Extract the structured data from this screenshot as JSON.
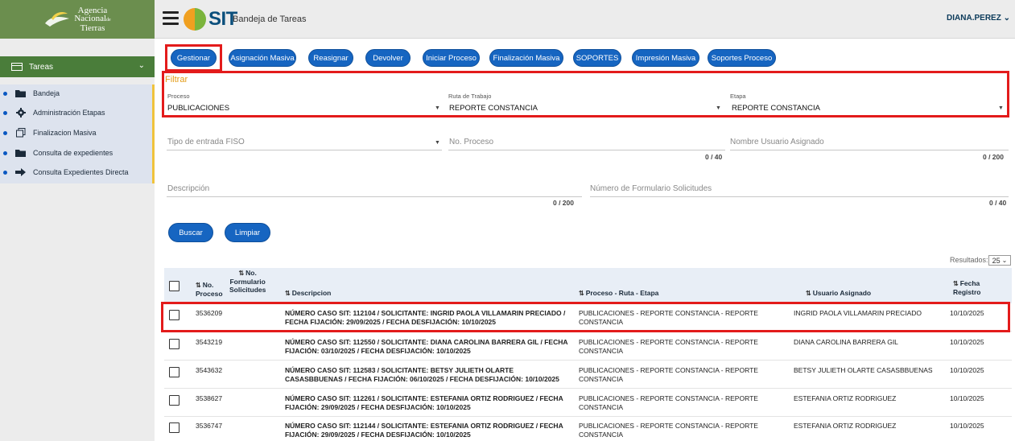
{
  "header": {
    "logo_lines": [
      "Agencia",
      "Nacional",
      "Tierras"
    ],
    "logo_small": "de",
    "brand": "SIT",
    "app_title": "Bandeja de Tareas",
    "user": "DIANA.PEREZ",
    "user_caret": "⌄"
  },
  "sidebar": {
    "section_label": "Tareas",
    "section_chevron": "⌄",
    "items": [
      {
        "label": "Bandeja",
        "icon": "folder-open-icon"
      },
      {
        "label": "Administración Etapas",
        "icon": "gear-icon"
      },
      {
        "label": "Finalizacion Masiva",
        "icon": "copy-icon"
      },
      {
        "label": "Consulta de expedientes",
        "icon": "folder-open-icon"
      },
      {
        "label": "Consulta Expedientes Directa",
        "icon": "arrow-right-icon"
      }
    ]
  },
  "toolbar": {
    "gestionar": "Gestionar",
    "asignacion_masiva": "Asignación Masiva",
    "reasignar": "Reasignar",
    "devolver": "Devolver",
    "iniciar_proceso": "Iniciar Proceso",
    "finalizacion_masiva": "Finalización Masiva",
    "soportes": "SOPORTES",
    "impresion_masiva": "Impresión Masiva",
    "soportes_proceso": "Soportes Proceso"
  },
  "filter": {
    "title": "Filtrar",
    "proceso_label": "Proceso",
    "proceso_value": "PUBLICACIONES",
    "ruta_label": "Ruta de Trabajo",
    "ruta_value": "REPORTE CONSTANCIA",
    "etapa_label": "Etapa",
    "etapa_value": "REPORTE CONSTANCIA",
    "tipo_entrada_placeholder": "Tipo de entrada FISO",
    "no_proceso_placeholder": "No. Proceso",
    "no_proceso_counter": "0 / 40",
    "nombre_usuario_placeholder": "Nombre Usuario Asignado",
    "nombre_usuario_counter": "0 / 200",
    "descripcion_placeholder": "Descripción",
    "descripcion_counter": "0 / 200",
    "numero_formulario_placeholder": "Número de Formulario Solicitudes",
    "numero_formulario_counter": "0 / 40",
    "buscar": "Buscar",
    "limpiar": "Limpiar"
  },
  "results": {
    "label": "Resultados:",
    "page_size": "25",
    "page_size_caret": "⌄"
  },
  "table": {
    "headers": {
      "no_proceso": [
        "No.",
        "Proceso"
      ],
      "no_formulario": [
        "No.",
        "Formulario",
        "Solicitudes"
      ],
      "descripcion": "Descripcion",
      "proceso_ruta_etapa": "Proceso - Ruta - Etapa",
      "usuario_asignado": "Usuario Asignado",
      "fecha_registro": [
        "Fecha",
        "Registro"
      ]
    },
    "rows": [
      {
        "proceso": "3536209",
        "desc1": "NÚMERO CASO SIT: 112104 / SOLICITANTE: INGRID PAOLA VILLAMARIN PRECIADO /",
        "desc2": "FECHA FIJACIÓN: 29/09/2025 / FECHA DESFIJACIÓN: 10/10/2025",
        "pre1": "PUBLICACIONES - REPORTE CONSTANCIA - REPORTE",
        "pre2": "CONSTANCIA",
        "usuario": "INGRID PAOLA VILLAMARIN PRECIADO",
        "fecha": "10/10/2025"
      },
      {
        "proceso": "3543219",
        "desc1": "NÚMERO CASO SIT: 112550 / SOLICITANTE: DIANA CAROLINA BARRERA GIL / FECHA",
        "desc2": "FIJACIÓN: 03/10/2025 / FECHA DESFIJACIÓN: 10/10/2025",
        "pre1": "PUBLICACIONES - REPORTE CONSTANCIA - REPORTE",
        "pre2": "CONSTANCIA",
        "usuario": "DIANA CAROLINA BARRERA GIL",
        "fecha": "10/10/2025"
      },
      {
        "proceso": "3543632",
        "desc1": "NÚMERO CASO SIT: 112583 / SOLICITANTE: BETSY JULIETH OLARTE",
        "desc2": "CASASBBUENAS / FECHA FIJACIÓN: 06/10/2025 / FECHA DESFIJACIÓN: 10/10/2025",
        "pre1": "PUBLICACIONES - REPORTE CONSTANCIA - REPORTE",
        "pre2": "CONSTANCIA",
        "usuario": "BETSY JULIETH OLARTE CASASBBUENAS",
        "fecha": "10/10/2025"
      },
      {
        "proceso": "3538627",
        "desc1": "NÚMERO CASO SIT: 112261 / SOLICITANTE: ESTEFANIA ORTIZ RODRIGUEZ / FECHA",
        "desc2": "FIJACIÓN: 29/09/2025 / FECHA DESFIJACIÓN: 10/10/2025",
        "pre1": "PUBLICACIONES - REPORTE CONSTANCIA - REPORTE",
        "pre2": "CONSTANCIA",
        "usuario": "ESTEFANIA ORTIZ RODRIGUEZ",
        "fecha": "10/10/2025"
      },
      {
        "proceso": "3536747",
        "desc1": "NÚMERO CASO SIT: 112144 / SOLICITANTE: ESTEFANIA ORTIZ RODRIGUEZ / FECHA",
        "desc2": "FIJACIÓN: 29/09/2025 / FECHA DESFIJACIÓN: 10/10/2025",
        "pre1": "PUBLICACIONES - REPORTE CONSTANCIA - REPORTE",
        "pre2": "CONSTANCIA",
        "usuario": "ESTEFANIA ORTIZ RODRIGUEZ",
        "fecha": "10/10/2025"
      }
    ]
  },
  "colors": {
    "primary_button": "#1665c1",
    "highlight_box": "#e31b1b",
    "filter_title": "#e39b16",
    "sidebar_header": "#4a7d3a",
    "logo_bg": "#6b8e4e"
  }
}
